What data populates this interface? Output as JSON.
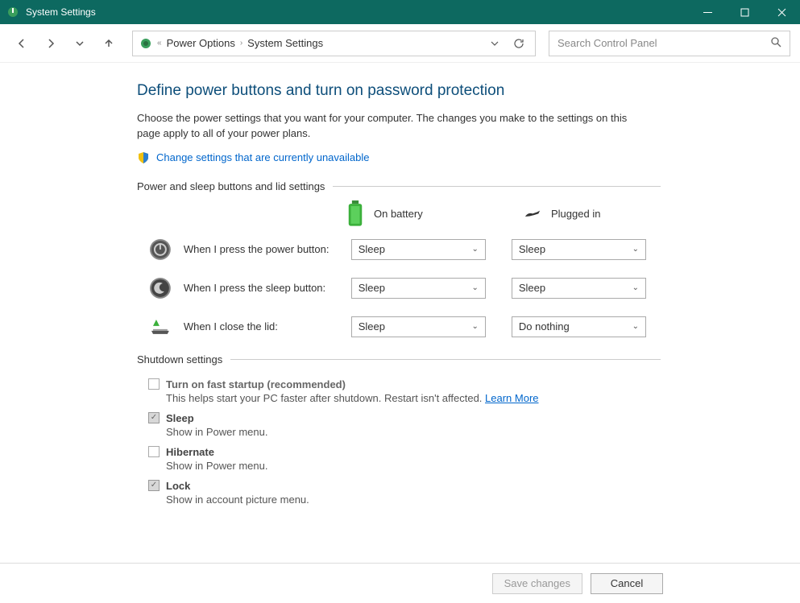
{
  "titlebar": {
    "title": "System Settings"
  },
  "breadcrumb": {
    "item1": "Power Options",
    "item2": "System Settings"
  },
  "search": {
    "placeholder": "Search Control Panel"
  },
  "main": {
    "heading": "Define power buttons and turn on password protection",
    "description": "Choose the power settings that you want for your computer. The changes you make to the settings on this page apply to all of your power plans.",
    "change_link": "Change settings that are currently unavailable",
    "section1_label": "Power and sleep buttons and lid settings",
    "mode_battery": "On battery",
    "mode_plugged": "Plugged in",
    "rows": {
      "power_button": {
        "label": "When I press the power button:",
        "battery": "Sleep",
        "plugged": "Sleep"
      },
      "sleep_button": {
        "label": "When I press the sleep button:",
        "battery": "Sleep",
        "plugged": "Sleep"
      },
      "close_lid": {
        "label": "When I close the lid:",
        "battery": "Sleep",
        "plugged": "Do nothing"
      }
    },
    "section2_label": "Shutdown settings",
    "shutdown": {
      "fast_startup": {
        "label": "Turn on fast startup (recommended)",
        "desc": "This helps start your PC faster after shutdown. Restart isn't affected. ",
        "learn_more": "Learn More"
      },
      "sleep": {
        "label": "Sleep",
        "desc": "Show in Power menu."
      },
      "hibernate": {
        "label": "Hibernate",
        "desc": "Show in Power menu."
      },
      "lock": {
        "label": "Lock",
        "desc": "Show in account picture menu."
      }
    }
  },
  "footer": {
    "save": "Save changes",
    "cancel": "Cancel"
  }
}
